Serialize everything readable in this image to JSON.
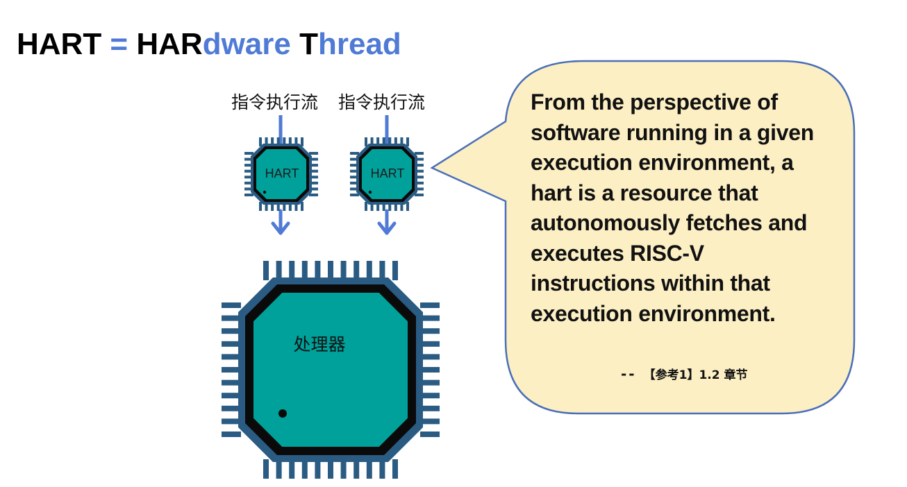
{
  "title": {
    "part1": "HART",
    "equals": " = ",
    "part2": "HAR",
    "part3": "dware",
    "part4": " T",
    "part5": "hread"
  },
  "diagram": {
    "stream_labels": [
      "指令执行流",
      "指令执行流"
    ],
    "hart_labels": [
      "HART",
      "HART"
    ],
    "processor_label": "处理器"
  },
  "callout": {
    "text": "From the perspective of software running in a given execution environment, a hart is a resource that autonomously fetches and executes RISC-V instructions within that execution environment.",
    "citation_dash": "--",
    "citation": "【参考1】1.2 章节"
  },
  "colors": {
    "chip_teal": "#00a19a",
    "chip_border": "#0d3b4e",
    "chip_pins": "#2a5b82",
    "arrow_blue": "#4f7ad6",
    "bubble_fill": "#fcefc4",
    "bubble_stroke": "#4a6fb8"
  }
}
